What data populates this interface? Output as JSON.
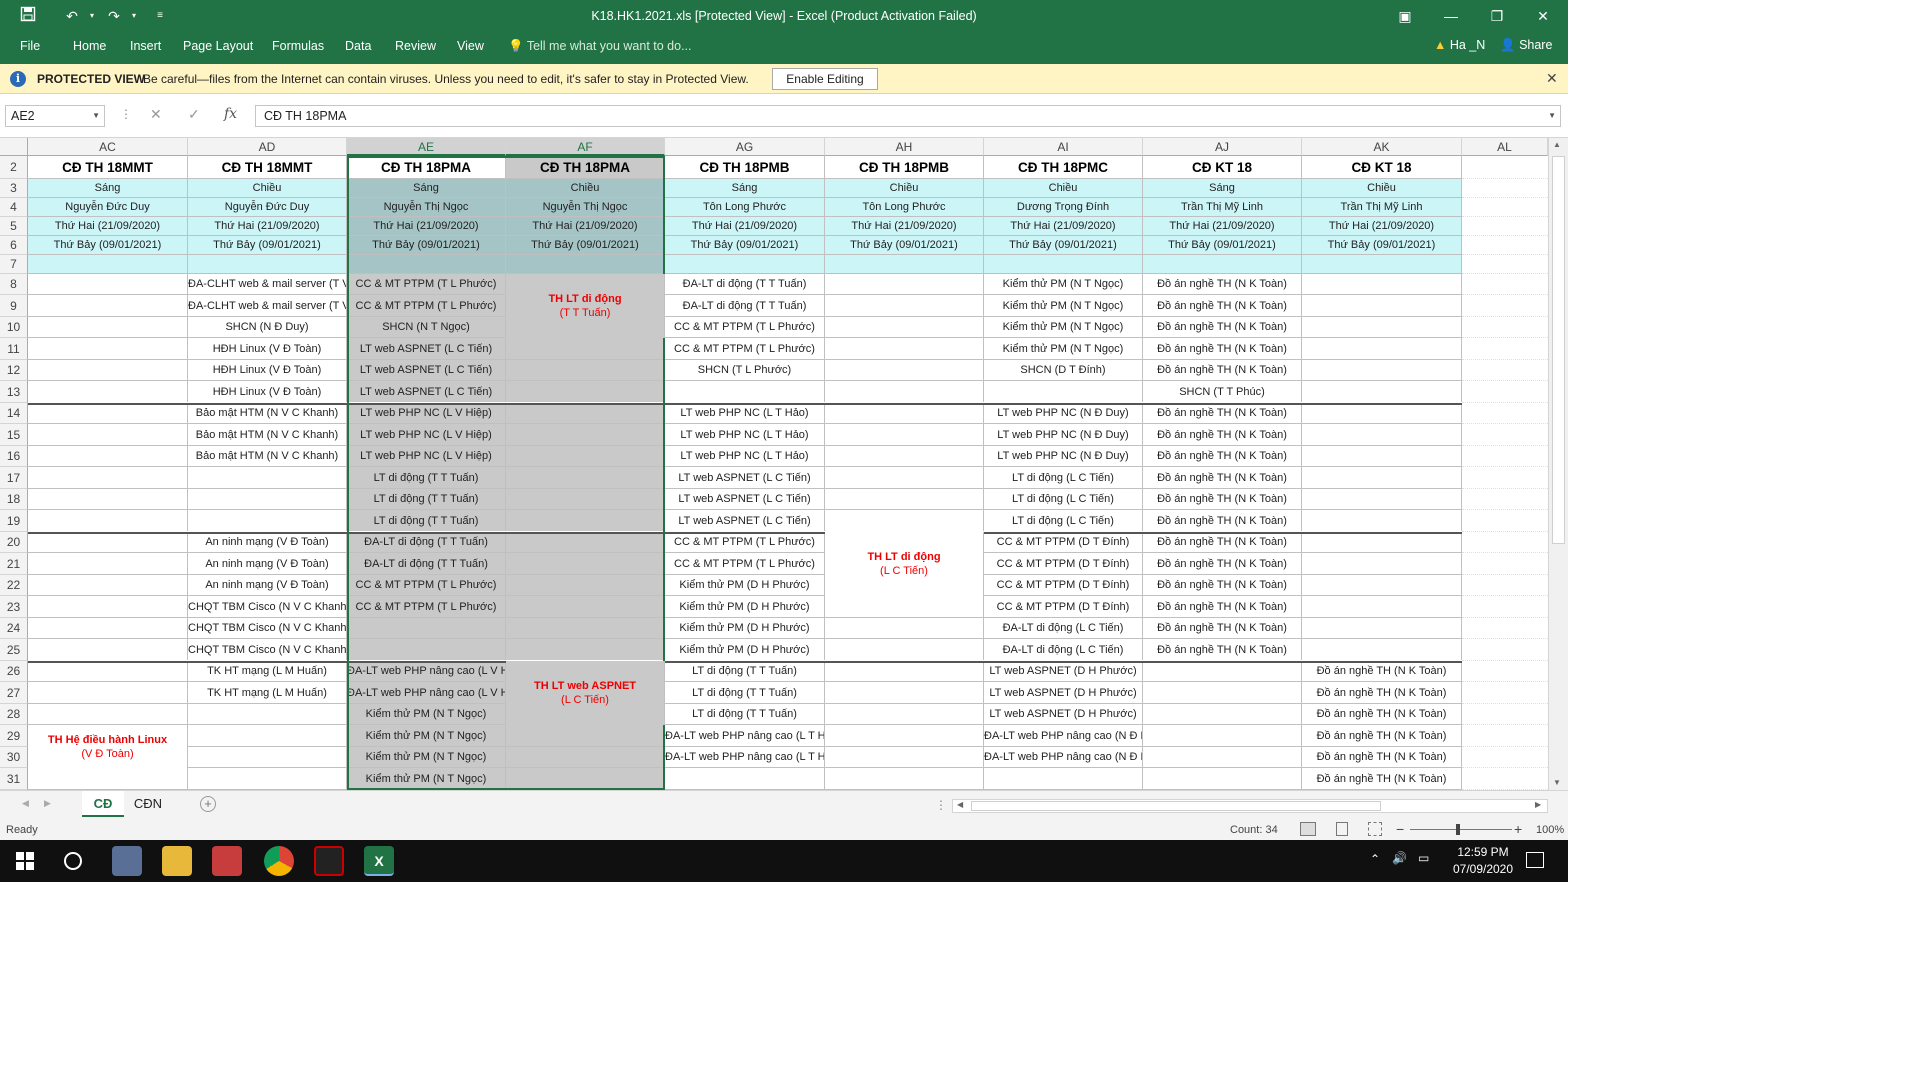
{
  "window": {
    "title": "K18.HK1.2021.xls  [Protected View] - Excel (Product Activation Failed)",
    "save_icon": "save-icon"
  },
  "ribbon": {
    "tabs": [
      "File",
      "Home",
      "Insert",
      "Page Layout",
      "Formulas",
      "Data",
      "Review",
      "View"
    ],
    "tell_me": "Tell me what you want to do...",
    "user": "Ha _N",
    "share": "Share"
  },
  "protected_view": {
    "title": "PROTECTED VIEW",
    "message": "Be careful—files from the Internet can contain viruses. Unless you need to edit, it's safer to stay in Protected View.",
    "button": "Enable Editing"
  },
  "formula_bar": {
    "name_box": "AE2",
    "formula": "CĐ TH 18PMA",
    "fx": "fx"
  },
  "columns": [
    "AC",
    "AD",
    "AE",
    "AF",
    "AG",
    "AH",
    "AI",
    "AJ",
    "AK",
    "AL"
  ],
  "rows": [
    "2",
    "3",
    "4",
    "5",
    "6",
    "7",
    "8",
    "9",
    "10",
    "11",
    "12",
    "13",
    "14",
    "15",
    "16",
    "17",
    "18",
    "19",
    "20",
    "21",
    "22",
    "23",
    "24",
    "25",
    "26",
    "27",
    "28",
    "29",
    "30",
    "31"
  ],
  "header_rows": {
    "class": [
      "CĐ TH 18MMT",
      "CĐ TH 18MMT",
      "CĐ TH 18PMA",
      "CĐ TH 18PMA",
      "CĐ TH 18PMB",
      "CĐ TH 18PMB",
      "CĐ TH 18PMC",
      "CĐ KT 18",
      "CĐ KT 18"
    ],
    "session": [
      "Sáng",
      "Chiều",
      "Sáng",
      "Chiều",
      "Sáng",
      "Chiều",
      "Chiều",
      "Sáng",
      "Chiều"
    ],
    "teacher": [
      "Nguyễn Đức Duy",
      "Nguyễn Đức Duy",
      "Nguyễn Thị Ngọc",
      "Nguyễn Thị Ngọc",
      "Tôn Long Phước",
      "Tôn Long Phước",
      "Dương Trọng Đính",
      "Trần Thị Mỹ Linh",
      "Trần Thị Mỹ Linh"
    ],
    "start": [
      "Thứ Hai (21/09/2020)",
      "Thứ Hai (21/09/2020)",
      "Thứ Hai (21/09/2020)",
      "Thứ Hai (21/09/2020)",
      "Thứ Hai (21/09/2020)",
      "Thứ Hai (21/09/2020)",
      "Thứ Hai (21/09/2020)",
      "Thứ Hai (21/09/2020)",
      "Thứ Hai (21/09/2020)"
    ],
    "end": [
      "Thứ Bảy (09/01/2021)",
      "Thứ Bảy (09/01/2021)",
      "Thứ Bảy (09/01/2021)",
      "Thứ Bảy (09/01/2021)",
      "Thứ Bảy (09/01/2021)",
      "Thứ Bảy (09/01/2021)",
      "Thứ Bảy (09/01/2021)",
      "Thứ Bảy (09/01/2021)",
      "Thứ Bảy (09/01/2021)"
    ]
  },
  "body": [
    [
      "",
      "ĐA-CLHT web & mail server (T V S Phú)",
      "CC & MT PTPM (T L Phước)",
      "",
      "ĐA-LT di động (T T Tuấn)",
      "",
      "Kiểm thử PM (N T Ngọc)",
      "Đồ án nghề TH (N K Toàn)",
      ""
    ],
    [
      "",
      "ĐA-CLHT web & mail server (T V S Phú)",
      "CC & MT PTPM (T L Phước)",
      "",
      "ĐA-LT di động (T T Tuấn)",
      "",
      "Kiểm thử PM (N T Ngọc)",
      "Đồ án nghề TH (N K Toàn)",
      ""
    ],
    [
      "",
      "SHCN (N Đ Duy)",
      "SHCN (N T Ngọc)",
      "",
      "CC & MT PTPM (T L Phước)",
      "",
      "Kiểm thử PM (N T Ngọc)",
      "Đồ án nghề TH (N K Toàn)",
      ""
    ],
    [
      "",
      "HĐH Linux (V Đ Toàn)",
      "LT web ASPNET (L C Tiến)",
      "",
      "CC & MT PTPM (T L Phước)",
      "",
      "Kiểm thử PM (N T Ngọc)",
      "Đồ án nghề TH (N K Toàn)",
      ""
    ],
    [
      "",
      "HĐH Linux (V Đ Toàn)",
      "LT web ASPNET (L C Tiến)",
      "",
      "SHCN (T L Phước)",
      "",
      "SHCN (D T Đính)",
      "Đồ án nghề TH (N K Toàn)",
      ""
    ],
    [
      "",
      "HĐH Linux (V Đ Toàn)",
      "LT web ASPNET (L C Tiến)",
      "",
      "",
      "",
      "",
      "SHCN (T T Phúc)",
      ""
    ],
    [
      "",
      "Bảo mật HTM (N V C Khanh)",
      "LT web PHP NC (L V Hiệp)",
      "",
      "LT web PHP NC (L T Hảo)",
      "",
      "LT web PHP NC (N Đ Duy)",
      "Đồ án nghề TH (N K Toàn)",
      ""
    ],
    [
      "",
      "Bảo mật HTM (N V C Khanh)",
      "LT web PHP NC (L V Hiệp)",
      "",
      "LT web PHP NC (L T Hảo)",
      "",
      "LT web PHP NC (N Đ Duy)",
      "Đồ án nghề TH (N K Toàn)",
      ""
    ],
    [
      "",
      "Bảo mật HTM (N V C Khanh)",
      "LT web PHP NC (L V Hiệp)",
      "",
      "LT web PHP NC (L T Hảo)",
      "",
      "LT web PHP NC (N Đ Duy)",
      "Đồ án nghề TH (N K Toàn)",
      ""
    ],
    [
      "",
      "",
      "LT di động (T T Tuấn)",
      "",
      "LT web ASPNET (L C Tiến)",
      "",
      "LT di động (L C Tiến)",
      "Đồ án nghề TH (N K Toàn)",
      ""
    ],
    [
      "",
      "",
      "LT di động (T T Tuấn)",
      "",
      "LT web ASPNET (L C Tiến)",
      "",
      "LT di động (L C Tiến)",
      "Đồ án nghề TH (N K Toàn)",
      ""
    ],
    [
      "",
      "",
      "LT di động (T T Tuấn)",
      "",
      "LT web ASPNET (L C Tiến)",
      "",
      "LT di động (L C Tiến)",
      "Đồ án nghề TH (N K Toàn)",
      ""
    ],
    [
      "",
      "An ninh mạng (V Đ Toàn)",
      "ĐA-LT di động (T T Tuấn)",
      "",
      "CC & MT PTPM (T L Phước)",
      "",
      "CC & MT PTPM (D T Đính)",
      "Đồ án nghề TH (N K Toàn)",
      ""
    ],
    [
      "",
      "An ninh mạng (V Đ Toàn)",
      "ĐA-LT di động (T T Tuấn)",
      "",
      "CC & MT PTPM (T L Phước)",
      "",
      "CC & MT PTPM (D T Đính)",
      "Đồ án nghề TH (N K Toàn)",
      ""
    ],
    [
      "",
      "An ninh mạng (V Đ Toàn)",
      "CC & MT PTPM (T L Phước)",
      "",
      "Kiểm thử PM (D H Phước)",
      "",
      "CC & MT PTPM (D T Đính)",
      "Đồ án nghề TH (N K Toàn)",
      ""
    ],
    [
      "",
      "CHQT TBM Cisco (N V C Khanh)",
      "CC & MT PTPM (T L Phước)",
      "",
      "Kiểm thử PM (D H Phước)",
      "",
      "CC & MT PTPM (D T Đính)",
      "Đồ án nghề TH (N K Toàn)",
      ""
    ],
    [
      "",
      "CHQT TBM Cisco (N V C Khanh)",
      "",
      "",
      "Kiểm thử PM (D H Phước)",
      "",
      "ĐA-LT di động (L C Tiến)",
      "Đồ án nghề TH (N K Toàn)",
      ""
    ],
    [
      "",
      "CHQT TBM Cisco (N V C Khanh)",
      "",
      "",
      "Kiểm thử PM (D H Phước)",
      "",
      "ĐA-LT di động (L C Tiến)",
      "Đồ án nghề TH (N K Toàn)",
      ""
    ],
    [
      "",
      "TK HT mạng (L M Huấn)",
      "ĐA-LT web PHP nâng cao (L V Hiệp)",
      "",
      "LT di động (T T Tuấn)",
      "",
      "LT web ASPNET (D H Phước)",
      "",
      "Đồ án nghề TH (N K Toàn)"
    ],
    [
      "",
      "TK HT mạng (L M Huấn)",
      "ĐA-LT web PHP nâng cao (L V Hiệp)",
      "",
      "LT di động (T T Tuấn)",
      "",
      "LT web ASPNET (D H Phước)",
      "",
      "Đồ án nghề TH (N K Toàn)"
    ],
    [
      "",
      "",
      "Kiểm thử PM (N T Ngọc)",
      "",
      "LT di động (T T Tuấn)",
      "",
      "LT web ASPNET (D H Phước)",
      "",
      "Đồ án nghề TH (N K Toàn)"
    ],
    [
      "",
      "",
      "Kiểm thử PM (N T Ngọc)",
      "",
      "ĐA-LT web PHP nâng cao (L T Hảo)",
      "",
      "ĐA-LT web PHP nâng cao (N Đ Duy)",
      "",
      "Đồ án nghề TH (N K Toàn)"
    ],
    [
      "",
      "",
      "Kiểm thử PM (N T Ngọc)",
      "",
      "ĐA-LT web PHP nâng cao (L T Hảo)",
      "",
      "ĐA-LT web PHP nâng cao (N Đ Duy)",
      "",
      "Đồ án nghề TH (N K Toàn)"
    ],
    [
      "",
      "",
      "Kiểm thử PM (N T Ngọc)",
      "",
      "",
      "",
      "",
      "",
      "Đồ án nghề TH (N K Toàn)"
    ]
  ],
  "merged_labels": [
    {
      "title": "TH LT di động",
      "sub": "(T T Tuấn)"
    },
    {
      "title": "TH LT di động",
      "sub": "(L C Tiến)"
    },
    {
      "title": "TH LT web ASPNET",
      "sub": "(L C Tiến)"
    },
    {
      "title": "TH Hệ điều hành Linux",
      "sub": "(V Đ Toàn)"
    }
  ],
  "sheets": [
    "CĐ",
    "CĐN"
  ],
  "status": {
    "ready": "Ready",
    "count": "Count: 34",
    "zoom": "100%"
  },
  "taskbar": {
    "time": "12:59 PM",
    "date": "07/09/2020"
  },
  "colors": {
    "excel_green": "#217346",
    "cyan_header": "#ccf5f7",
    "selected_gray": "#c9c9c9",
    "red_text": "#e00000"
  }
}
